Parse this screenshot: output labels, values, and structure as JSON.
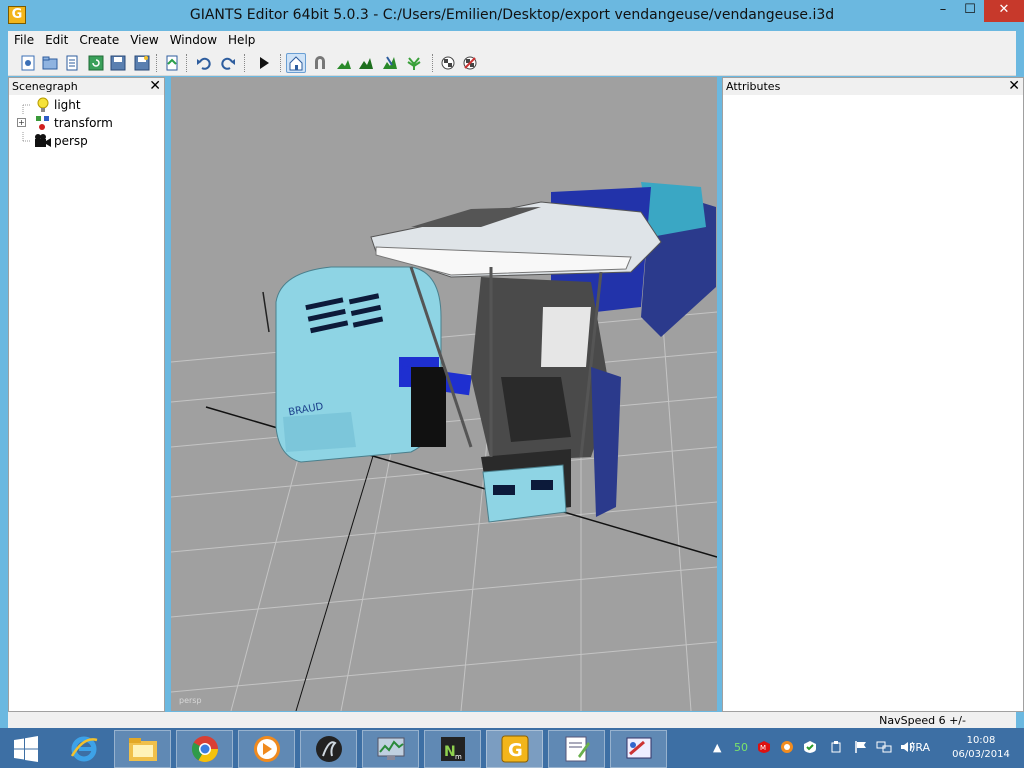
{
  "window": {
    "title": "GIANTS Editor 64bit 5.0.3 - C:/Users/Emilien/Desktop/export vendangeuse/vendangeuse.i3d",
    "app_icon_letter": "G",
    "minimize": "–",
    "maximize": "☐",
    "close": "✕"
  },
  "menubar": {
    "items": [
      "File",
      "Edit",
      "Create",
      "View",
      "Window",
      "Help"
    ]
  },
  "toolbar": {
    "icons": [
      "new-scene-icon",
      "open-icon",
      "list-icon",
      "reload-icon",
      "save-icon",
      "save-as-icon",
      "import-icon",
      "undo-icon",
      "redo-icon",
      "play-icon",
      "home-icon",
      "magnet-icon",
      "terrain-icon",
      "terrain-paint-icon",
      "terrain-sculpt-icon",
      "foliage-icon",
      "checker-icon",
      "checker-cancel-icon"
    ]
  },
  "scenegraph": {
    "title": "Scenegraph",
    "close": "✕",
    "items": [
      {
        "label": "light",
        "icon": "light-bulb-icon"
      },
      {
        "label": "transform",
        "icon": "transform-icon",
        "expander": "+"
      },
      {
        "label": "persp",
        "icon": "camera-icon"
      }
    ]
  },
  "attributes": {
    "title": "Attributes",
    "close": "✕"
  },
  "viewport": {
    "camera_label": "persp",
    "model_badge": "BRAUD"
  },
  "statusbar": {
    "navspeed": "NavSpeed 6 +/-"
  },
  "taskbar": {
    "apps": [
      "start-icon",
      "internet-explorer-icon",
      "file-explorer-icon",
      "chrome-icon",
      "media-player-icon",
      "blender-icon",
      "resource-monitor-icon",
      "notepad-plus-plus-icon",
      "giants-editor-icon",
      "text-editor-icon",
      "paint-icon"
    ],
    "tray": {
      "counter": "50",
      "language": "FRA",
      "time": "10:08",
      "date": "06/03/2014"
    }
  },
  "colors": {
    "titlebar": "#6bb8e0",
    "taskbar": "#3d6fa4",
    "viewport_bg": "#a0a0a0",
    "close_button": "#c7392b"
  }
}
